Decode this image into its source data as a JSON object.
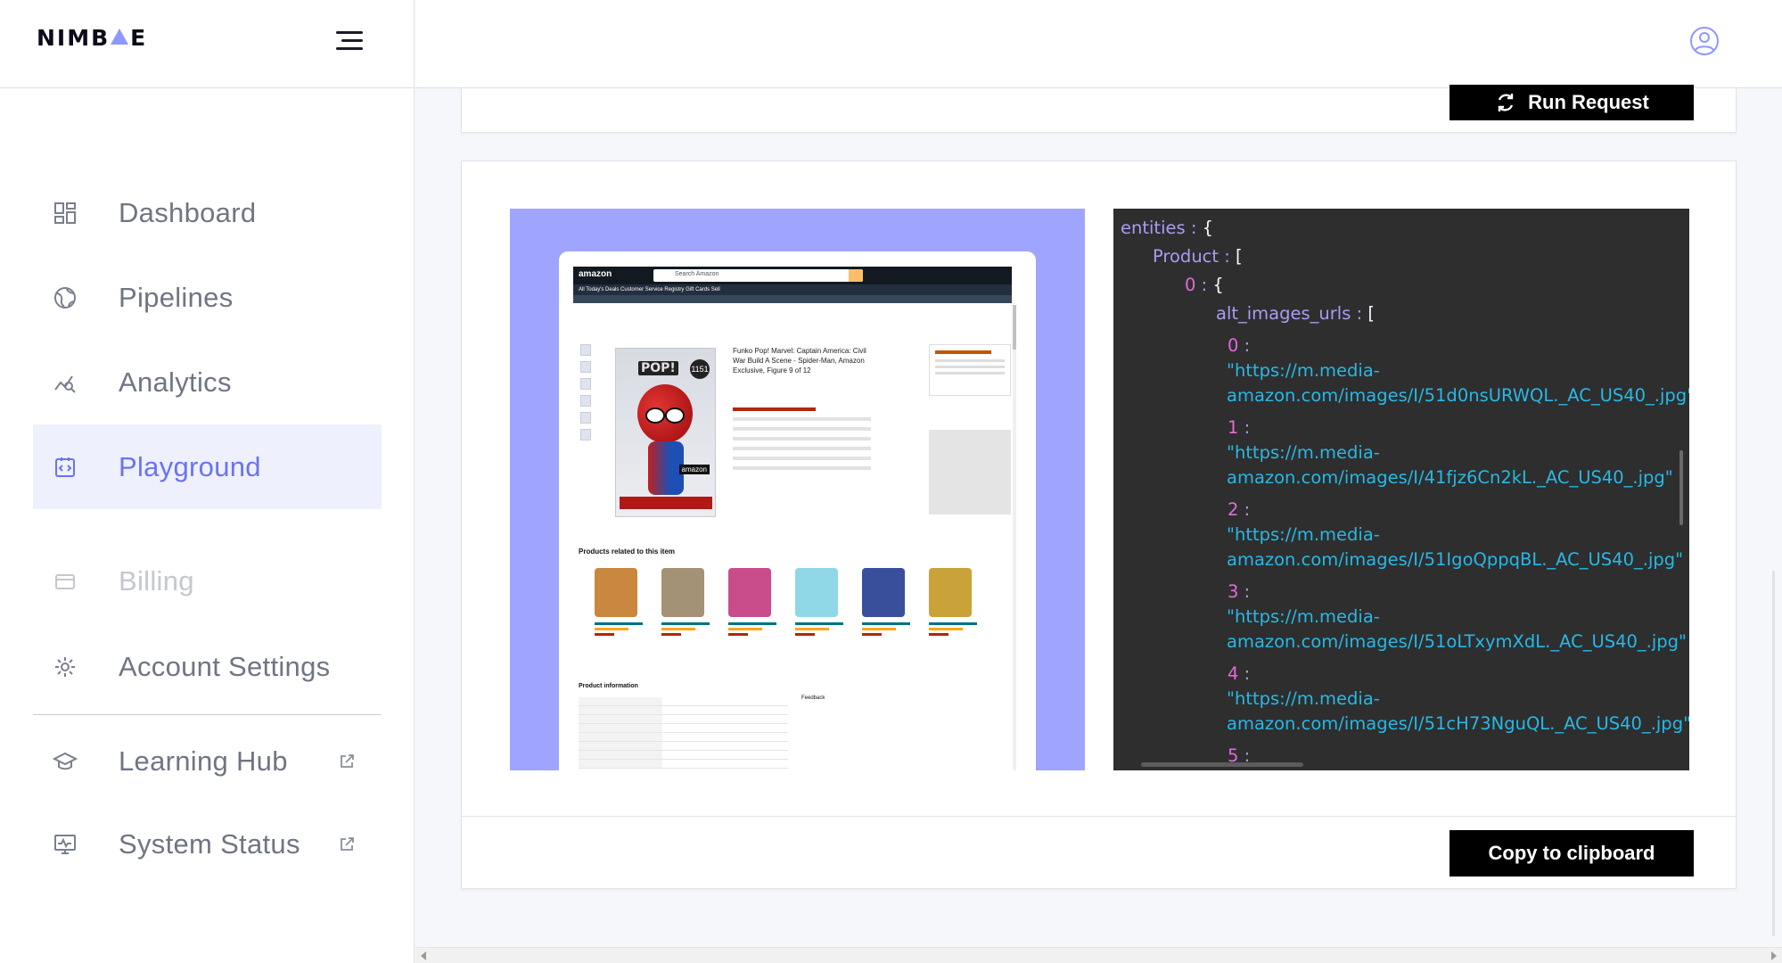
{
  "brand": {
    "name_left": "NIMB",
    "name_right": "E",
    "logo_accent": "#8f97ff"
  },
  "sidebar": {
    "items": [
      {
        "label": "Dashboard",
        "icon": "dashboard-icon"
      },
      {
        "label": "Pipelines",
        "icon": "globe-icon"
      },
      {
        "label": "Analytics",
        "icon": "analytics-icon"
      },
      {
        "label": "Playground",
        "icon": "playground-icon",
        "active": true
      },
      {
        "label": "Billing",
        "icon": "credit-card-icon",
        "disabled": true
      },
      {
        "label": "Account Settings",
        "icon": "gear-icon"
      },
      {
        "label": "Learning Hub",
        "icon": "graduation-cap-icon",
        "external": true
      },
      {
        "label": "System Status",
        "icon": "monitor-icon",
        "external": true
      }
    ]
  },
  "toolbar": {
    "run_label": "Run Request",
    "copy_label": "Copy to clipboard"
  },
  "preview": {
    "amazon_logo": "amazon",
    "search_placeholder": "Search Amazon",
    "nav_text": "All   Today's Deals   Customer Service   Registry   Gift Cards   Sell",
    "product_title": "Funko Pop! Marvel: Captain America: Civil War Build A Scene - Spider-Man, Amazon Exclusive, Figure 9 of 12",
    "related_title": "Products related to this item",
    "product_info_title": "Product information",
    "feedback_label": "Feedback",
    "pop_text": "POP!",
    "pop_number": "1151",
    "amazon_tag": "amazon"
  },
  "json_view": {
    "entities": "entities",
    "product": "Product",
    "index0": "0",
    "alt_key": "alt_images_urls",
    "urls": [
      {
        "index": "0",
        "line1": "\"https://m.media-",
        "line2": "amazon.com/images/I/51d0nsURWQL._AC_US40_.jpg\""
      },
      {
        "index": "1",
        "line1": "\"https://m.media-",
        "line2": "amazon.com/images/I/41fjz6Cn2kL._AC_US40_.jpg\""
      },
      {
        "index": "2",
        "line1": "\"https://m.media-",
        "line2": "amazon.com/images/I/51IgoQppqBL._AC_US40_.jpg\""
      },
      {
        "index": "3",
        "line1": "\"https://m.media-",
        "line2": "amazon.com/images/I/51oLTxymXdL._AC_US40_.jpg\""
      },
      {
        "index": "4",
        "line1": "\"https://m.media-",
        "line2": "amazon.com/images/I/51cH73NguQL._AC_US40_.jpg\""
      }
    ],
    "next_index": "5",
    "colors": {
      "key": "#a99cf2",
      "index": "#e06bd8",
      "string": "#27b8e6",
      "bg": "#2e2e2e"
    }
  },
  "colors": {
    "accent": "#6a73f1",
    "active_bg": "#eef0fd",
    "preview_bg": "#9fa5ff"
  }
}
